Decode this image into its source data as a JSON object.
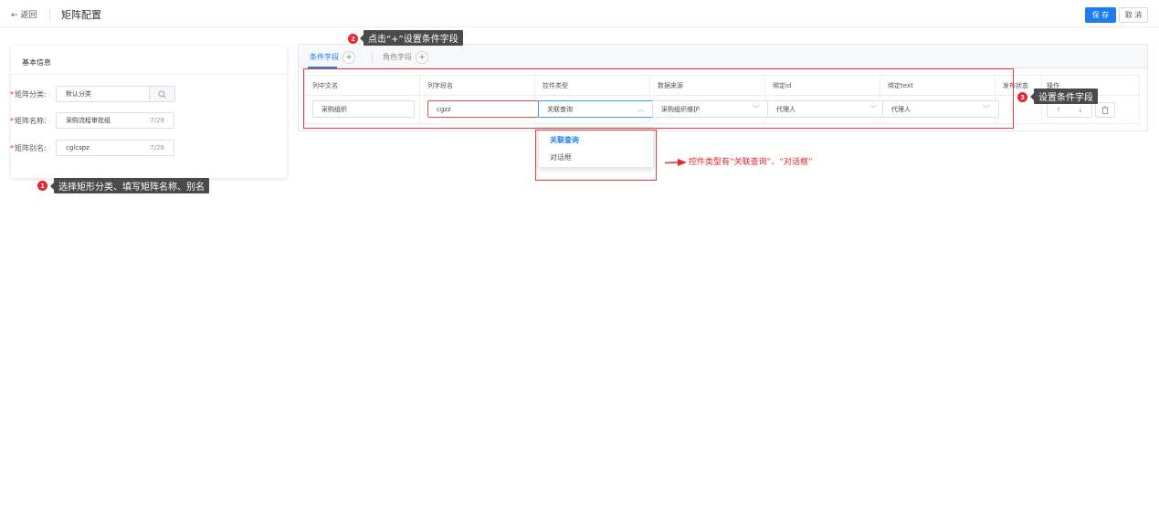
{
  "header": {
    "back_label": "← 返回",
    "title": "矩阵配置",
    "save_label": "保 存",
    "cancel_label": "取 消"
  },
  "basic_info": {
    "title": "基本信息",
    "fields": [
      {
        "label": "矩阵分类:",
        "value": "默认分类"
      },
      {
        "label": "矩阵名称:",
        "value": "采购流程审批组",
        "count": "7/28"
      },
      {
        "label": "矩阵别名:",
        "value": "cglcspz",
        "count": "7/28"
      }
    ]
  },
  "tabs": [
    {
      "label": "条件字段",
      "active": true
    },
    {
      "label": "角色字段",
      "active": false
    }
  ],
  "table": {
    "headers": [
      "列中文名",
      "列字段名",
      "控件类型",
      "数据来源",
      "绑定id",
      "绑定text",
      "发布状态",
      "操作"
    ],
    "row": {
      "col_cn_name": "采购组织",
      "col_field_name": "cgzz",
      "control_type": "关联查询",
      "data_source": "采购组织维护",
      "bind_id": "代理人",
      "bind_text": "代理人"
    }
  },
  "dropdown": {
    "options": [
      "关联查询",
      "对话框"
    ],
    "selected": "关联查询"
  },
  "annotations": {
    "step1": {
      "num": "1",
      "text": "选择矩形分类、填写矩阵名称、别名"
    },
    "step2": {
      "num": "2",
      "text": "点击“+”设置条件字段"
    },
    "step3": {
      "num": "3",
      "text": "设置条件字段"
    },
    "arrow_text": "控件类型有“关联查询”、“对话框”"
  },
  "colors": {
    "accent": "#1d7df0",
    "annotation_red": "#e8232e",
    "tooltip_bg": "#4a4a4a"
  }
}
